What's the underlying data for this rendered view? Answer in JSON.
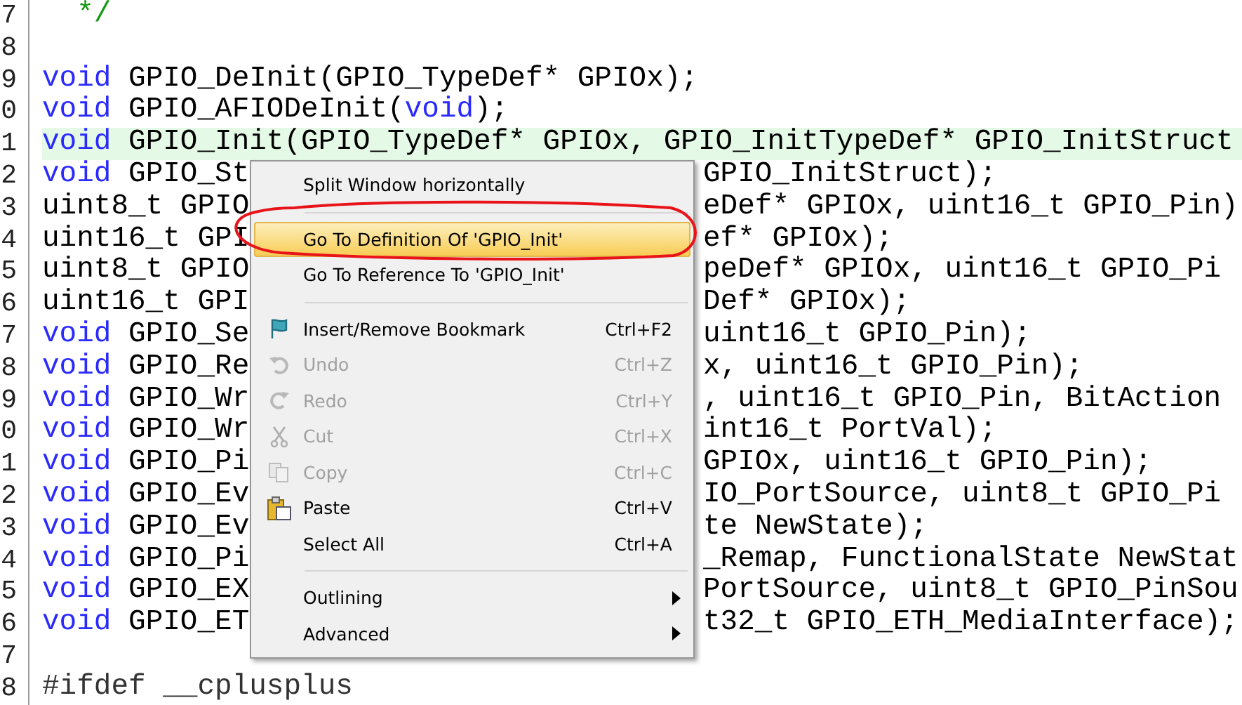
{
  "editor": {
    "lines": [
      {
        "number": "7",
        "highlighted": false,
        "left": [
          {
            "kind": "comment",
            "text": "  */"
          }
        ]
      },
      {
        "number": "8",
        "highlighted": false
      },
      {
        "number": "9",
        "highlighted": false,
        "left": [
          {
            "kind": "keyword",
            "text": "void"
          },
          {
            "kind": "plain",
            "text": " GPIO_DeInit(GPIO_TypeDef* GPIOx);"
          }
        ]
      },
      {
        "number": "0",
        "highlighted": false,
        "left": [
          {
            "kind": "keyword",
            "text": "void"
          },
          {
            "kind": "plain",
            "text": " GPIO_AFIODeInit("
          },
          {
            "kind": "keyword",
            "text": "void"
          },
          {
            "kind": "plain",
            "text": ");"
          }
        ]
      },
      {
        "number": "1",
        "highlighted": true,
        "left": [
          {
            "kind": "keyword",
            "text": "void"
          },
          {
            "kind": "plain",
            "text": " GPIO_Init(GPIO_TypeDef* GPIOx, GPIO_InitTypeDef* GPIO_InitStruct"
          }
        ]
      },
      {
        "number": "2",
        "highlighted": false,
        "left": [
          {
            "kind": "keyword",
            "text": "void"
          },
          {
            "kind": "plain",
            "text": " GPIO_St"
          }
        ],
        "right": "GPIO_InitStruct);"
      },
      {
        "number": "3",
        "highlighted": false,
        "left": [
          {
            "kind": "plain",
            "text": "uint8_t GPIO"
          }
        ],
        "right": "eDef* GPIOx, uint16_t GPIO_Pin)"
      },
      {
        "number": "4",
        "highlighted": false,
        "left": [
          {
            "kind": "plain",
            "text": "uint16_t GPI"
          }
        ],
        "right": "ef* GPIOx);"
      },
      {
        "number": "5",
        "highlighted": false,
        "left": [
          {
            "kind": "plain",
            "text": "uint8_t GPIO"
          }
        ],
        "right": "peDef* GPIOx, uint16_t GPIO_Pi"
      },
      {
        "number": "6",
        "highlighted": false,
        "left": [
          {
            "kind": "plain",
            "text": "uint16_t GPI"
          }
        ],
        "right": "Def* GPIOx);"
      },
      {
        "number": "7",
        "highlighted": false,
        "left": [
          {
            "kind": "keyword",
            "text": "void"
          },
          {
            "kind": "plain",
            "text": " GPIO_Se"
          }
        ],
        "right": "uint16_t GPIO_Pin);"
      },
      {
        "number": "8",
        "highlighted": false,
        "left": [
          {
            "kind": "keyword",
            "text": "void"
          },
          {
            "kind": "plain",
            "text": " GPIO_Re"
          }
        ],
        "right": "x, uint16_t GPIO_Pin);"
      },
      {
        "number": "9",
        "highlighted": false,
        "left": [
          {
            "kind": "keyword",
            "text": "void"
          },
          {
            "kind": "plain",
            "text": " GPIO_Wr"
          }
        ],
        "right": ", uint16_t GPIO_Pin, BitAction"
      },
      {
        "number": "0",
        "highlighted": false,
        "left": [
          {
            "kind": "keyword",
            "text": "void"
          },
          {
            "kind": "plain",
            "text": " GPIO_Wr"
          }
        ],
        "right": "int16_t PortVal);"
      },
      {
        "number": "1",
        "highlighted": false,
        "left": [
          {
            "kind": "keyword",
            "text": "void"
          },
          {
            "kind": "plain",
            "text": " GPIO_Pi"
          }
        ],
        "right": "GPIOx, uint16_t GPIO_Pin);"
      },
      {
        "number": "2",
        "highlighted": false,
        "left": [
          {
            "kind": "keyword",
            "text": "void"
          },
          {
            "kind": "plain",
            "text": " GPIO_Ev"
          }
        ],
        "right": "IO_PortSource, uint8_t GPIO_Pi"
      },
      {
        "number": "3",
        "highlighted": false,
        "left": [
          {
            "kind": "keyword",
            "text": "void"
          },
          {
            "kind": "plain",
            "text": " GPIO_Ev"
          }
        ],
        "right": "te NewState);"
      },
      {
        "number": "4",
        "highlighted": false,
        "left": [
          {
            "kind": "keyword",
            "text": "void"
          },
          {
            "kind": "plain",
            "text": " GPIO_Pi"
          }
        ],
        "right": "_Remap, FunctionalState NewStat"
      },
      {
        "number": "5",
        "highlighted": false,
        "left": [
          {
            "kind": "keyword",
            "text": "void"
          },
          {
            "kind": "plain",
            "text": " GPIO_EX"
          }
        ],
        "right": "PortSource, uint8_t GPIO_PinSou"
      },
      {
        "number": "6",
        "highlighted": false,
        "left": [
          {
            "kind": "keyword",
            "text": "void"
          },
          {
            "kind": "plain",
            "text": " GPIO_ET"
          }
        ],
        "right": "t32_t GPIO_ETH_MediaInterface);"
      },
      {
        "number": "7",
        "highlighted": false
      },
      {
        "number": "8",
        "highlighted": false,
        "left": [
          {
            "kind": "preprocessor",
            "text": "#ifdef __cplusplus"
          }
        ]
      }
    ]
  },
  "context_menu": {
    "items": [
      {
        "kind": "item",
        "label": "Split Window horizontally",
        "disabled": false,
        "selected": false,
        "submenu": false
      },
      {
        "kind": "separator"
      },
      {
        "kind": "item",
        "label": "Go To Definition Of 'GPIO_Init'",
        "disabled": false,
        "selected": true,
        "submenu": false
      },
      {
        "kind": "item",
        "label": "Go To Reference To 'GPIO_Init'",
        "disabled": false,
        "selected": false,
        "submenu": false
      },
      {
        "kind": "separator"
      },
      {
        "kind": "item",
        "label": "Insert/Remove Bookmark",
        "shortcut": "Ctrl+F2",
        "disabled": false,
        "selected": false,
        "submenu": false
      },
      {
        "kind": "item",
        "label": "Undo",
        "shortcut": "Ctrl+Z",
        "disabled": true,
        "selected": false,
        "submenu": false
      },
      {
        "kind": "item",
        "label": "Redo",
        "shortcut": "Ctrl+Y",
        "disabled": true,
        "selected": false,
        "submenu": false
      },
      {
        "kind": "item",
        "label": "Cut",
        "shortcut": "Ctrl+X",
        "disabled": true,
        "selected": false,
        "submenu": false
      },
      {
        "kind": "item",
        "label": "Copy",
        "shortcut": "Ctrl+C",
        "disabled": true,
        "selected": false,
        "submenu": false
      },
      {
        "kind": "item",
        "label": "Paste",
        "shortcut": "Ctrl+V",
        "disabled": false,
        "selected": false,
        "submenu": false
      },
      {
        "kind": "item",
        "label": "Select All",
        "shortcut": "Ctrl+A",
        "disabled": false,
        "selected": false,
        "submenu": false
      },
      {
        "kind": "separator"
      },
      {
        "kind": "item",
        "label": "Outlining",
        "disabled": false,
        "selected": false,
        "submenu": true
      },
      {
        "kind": "item",
        "label": "Advanced",
        "disabled": false,
        "selected": false,
        "submenu": true
      }
    ]
  }
}
